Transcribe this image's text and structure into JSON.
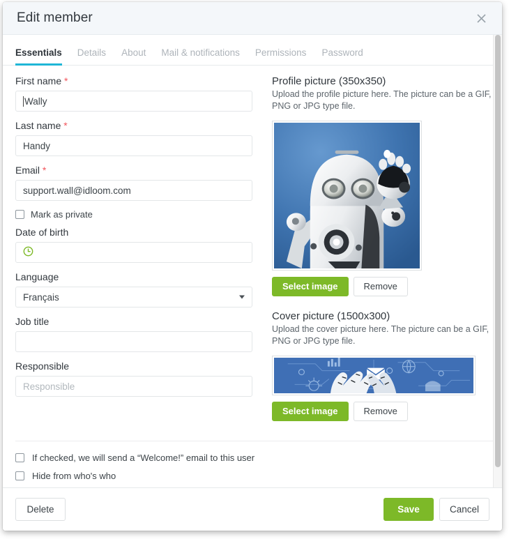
{
  "dialog": {
    "title": "Edit member",
    "close_icon": "close-icon"
  },
  "tabs": [
    {
      "label": "Essentials",
      "active": true
    },
    {
      "label": "Details",
      "active": false
    },
    {
      "label": "About",
      "active": false
    },
    {
      "label": "Mail & notifications",
      "active": false
    },
    {
      "label": "Permissions",
      "active": false
    },
    {
      "label": "Password",
      "active": false
    }
  ],
  "form": {
    "first_name": {
      "label": "First name",
      "required": "*",
      "value": "Wally",
      "placeholder": ""
    },
    "last_name": {
      "label": "Last name",
      "required": "*",
      "value": "Handy",
      "placeholder": ""
    },
    "email": {
      "label": "Email",
      "required": "*",
      "value": "support.wall@idloom.com",
      "placeholder": ""
    },
    "mark_private": {
      "label": "Mark as private",
      "checked": false
    },
    "date_of_birth": {
      "label": "Date of birth",
      "value": "",
      "icon": "clock-icon"
    },
    "language": {
      "label": "Language",
      "value": "Français"
    },
    "job_title": {
      "label": "Job title",
      "value": "",
      "placeholder": ""
    },
    "responsible": {
      "label": "Responsible",
      "value": "",
      "placeholder": "Responsible"
    }
  },
  "profile_picture": {
    "title": "Profile picture (350x350)",
    "description": "Upload the profile picture here. The picture can be a GIF, PNG or JPG type file.",
    "select_label": "Select image",
    "remove_label": "Remove"
  },
  "cover_picture": {
    "title": "Cover picture (1500x300)",
    "description": "Upload the cover picture here. The picture can be a GIF, PNG or JPG type file.",
    "select_label": "Select image",
    "remove_label": "Remove"
  },
  "bottom_options": [
    {
      "label": "If checked, we will send a “Welcome!” email to this user",
      "checked": false
    },
    {
      "label": "Hide from who's who",
      "checked": false
    }
  ],
  "footer": {
    "delete_label": "Delete",
    "save_label": "Save",
    "cancel_label": "Cancel"
  },
  "colors": {
    "accent_green": "#7db928",
    "tab_underline": "#1fb6d6",
    "required_red": "#f2545b",
    "header_bg": "#f4f7fa",
    "clock_green": "#7db928"
  }
}
